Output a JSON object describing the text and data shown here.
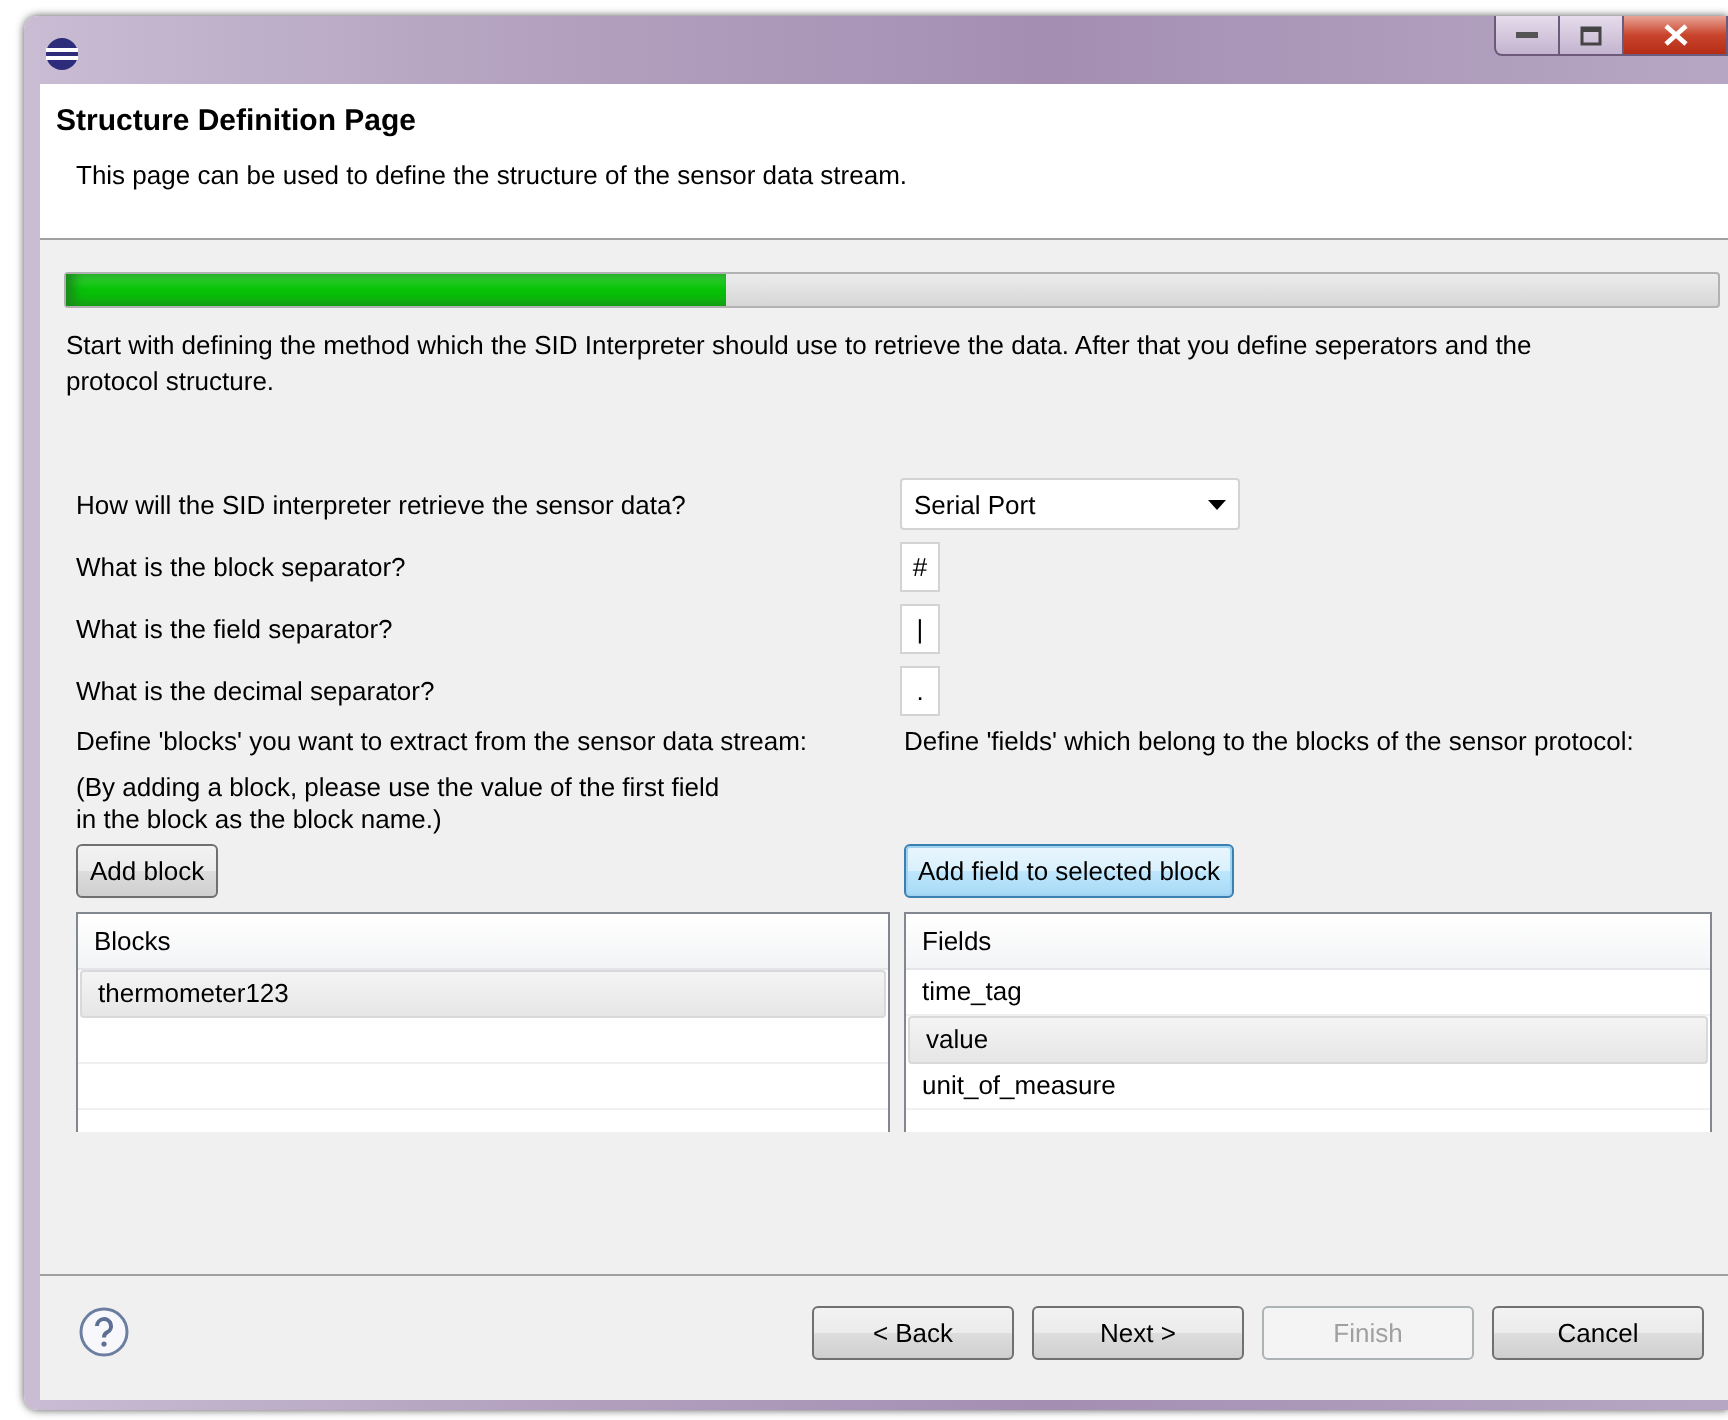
{
  "header": {
    "title": "Structure Definition Page",
    "description": "This page can be used to define the structure of the sensor data stream."
  },
  "progress": {
    "level": 0.4
  },
  "instructions": "Start with defining the method which the SID Interpreter should use to retrieve the data. After that you define seperators and the protocol structure.",
  "questions": [
    {
      "label": "How will the SID interpreter retrieve the sensor data?",
      "kind": "combo",
      "value": "Serial Port"
    },
    {
      "label": "What is the block separator?",
      "kind": "text",
      "value": "#"
    },
    {
      "label": "What is the field separator?",
      "kind": "text",
      "value": "|"
    },
    {
      "label": "What is the decimal separator?",
      "kind": "text",
      "value": "."
    }
  ],
  "blocks_panel": {
    "prompt": "Define 'blocks' you want to extract from the sensor data stream:",
    "note_lines": [
      "(By adding a block, please use the value of the first field",
      "in the block as the block name.)"
    ],
    "button": {
      "label": "Add block",
      "focused": false
    },
    "column": "Blocks",
    "rows": [
      {
        "text": "thermometer123",
        "selected": true
      }
    ]
  },
  "fields_panel": {
    "prompt": "Define 'fields' which belong to the blocks of the sensor protocol:",
    "button": {
      "label": "Add field to selected block",
      "focused": true
    },
    "column": "Fields",
    "rows": [
      {
        "text": "time_tag",
        "selected": false
      },
      {
        "text": "value",
        "selected": true
      },
      {
        "text": "unit_of_measure",
        "selected": false
      }
    ]
  },
  "footer": {
    "buttons": [
      {
        "label": "< Back",
        "disabled": false
      },
      {
        "label": "Next >",
        "disabled": false
      },
      {
        "label": "Finish",
        "disabled": true
      },
      {
        "label": "Cancel",
        "disabled": false
      }
    ]
  }
}
